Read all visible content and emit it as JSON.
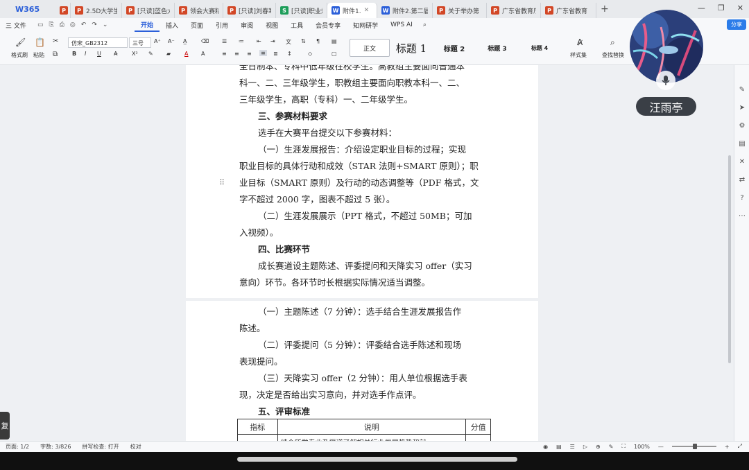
{
  "tabs": {
    "brand": "W365",
    "items": [
      {
        "icon": "P",
        "type": "p",
        "label": "",
        "w": 22
      },
      {
        "icon": "P",
        "type": "p",
        "label": "2.5D大学生职",
        "w": 74
      },
      {
        "icon": "P",
        "type": "p",
        "label": "[只读]蓝色大",
        "w": 76
      },
      {
        "icon": "P",
        "type": "p",
        "label": "领会大赛精",
        "w": 70
      },
      {
        "icon": "P",
        "type": "p",
        "label": "[只读]刘春寒",
        "w": 76
      },
      {
        "icon": "S",
        "type": "s",
        "label": "[只读]职业规",
        "w": 74
      },
      {
        "icon": "W",
        "type": "w",
        "label": "附件1.",
        "w": 72,
        "active": true
      },
      {
        "icon": "W",
        "type": "w",
        "label": "附件2.第二届",
        "w": 80
      },
      {
        "icon": "P",
        "type": "p",
        "label": "关于举办第",
        "w": 78
      },
      {
        "icon": "P",
        "type": "p",
        "label": "广东省教育厅",
        "w": 78
      },
      {
        "icon": "P",
        "type": "p",
        "label": "广东省教育",
        "w": 80
      }
    ],
    "new_tab": "+"
  },
  "menu": {
    "file": "三 文件",
    "items": [
      "开始",
      "插入",
      "页面",
      "引用",
      "审阅",
      "视图",
      "工具",
      "会员专享",
      "知网研学",
      "WPS AI"
    ],
    "active": "开始",
    "share": "分享"
  },
  "ribbon": {
    "format_painter": "格式刷",
    "paste": "粘贴",
    "font_name": "仿宋_GB2312",
    "font_size": "三号",
    "styles": {
      "normal": "正文",
      "h1": "标题 1",
      "h2": "标题 2",
      "h3": "标题 3",
      "h4": "标题 4"
    },
    "style_set": "样式集",
    "find_replace": "查找替换"
  },
  "document": {
    "page1_lines": [
      {
        "t": "全日制本、专科中低年级在校学生。高教组主要面向普通本",
        "ind": false
      },
      {
        "t": "科一、二、三年级学生，职教组主要面向职教本科一、二、",
        "ind": false
      },
      {
        "t": "三年级学生，高职（专科）一、二年级学生。",
        "ind": false
      },
      {
        "t": "三、参赛材料要求",
        "ind": true,
        "bold": true
      },
      {
        "t": "选手在大赛平台提交以下参赛材料：",
        "ind": true
      },
      {
        "t": "（一）生涯发展报告：介绍设定职业目标的过程；实现",
        "ind": true
      },
      {
        "t": "职业目标的具体行动和成效（STAR 法则+SMART 原则）；职",
        "ind": false
      },
      {
        "t": "业目标（SMART 原则）及行动的动态调整等（PDF 格式，文",
        "ind": false
      },
      {
        "t": "字不超过 2000 字，图表不超过 5 张）。",
        "ind": false
      },
      {
        "t": "（二）生涯发展展示（PPT 格式，不超过 50MB；可加",
        "ind": true
      },
      {
        "t": "入视频）。",
        "ind": false
      },
      {
        "t": "四、比赛环节",
        "ind": true,
        "bold": true
      },
      {
        "t": "成长赛道设主题陈述、评委提问和天降实习 offer（实习",
        "ind": true
      },
      {
        "t": "意向）环节。各环节时长根据实际情况适当调整。",
        "ind": false
      }
    ],
    "page2_lines": [
      {
        "t": "（一）主题陈述（7 分钟）：选手结合生涯发展报告作",
        "ind": true
      },
      {
        "t": "陈述。",
        "ind": false
      },
      {
        "t": "（二）评委提问（5 分钟）：评委结合选手陈述和现场",
        "ind": true
      },
      {
        "t": "表现提问。",
        "ind": false
      },
      {
        "t": "（三）天降实习 offer（2 分钟）：用人单位根据选手表",
        "ind": true
      },
      {
        "t": "现，决定是否给出实习意向，并对选手作点评。",
        "ind": false
      },
      {
        "t": "五、评审标准",
        "ind": true,
        "bold": true
      }
    ],
    "table": {
      "headers": [
        "指标",
        "说明",
        "分值"
      ],
      "row2": "结合所学专业及渠道了解相关行业发展趋势和就"
    }
  },
  "status": {
    "page": "页面: 1/2",
    "words": "字数: 3/826",
    "spell": "拼写检查: 打开",
    "proof": "校对",
    "zoom": "100%"
  },
  "participant": {
    "name": "汪雨亭"
  },
  "left_fab": "复"
}
